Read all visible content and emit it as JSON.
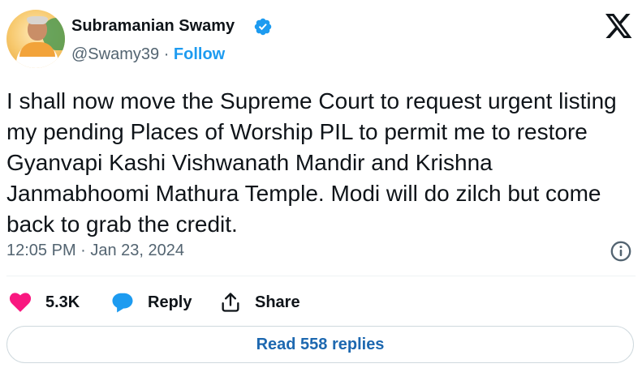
{
  "author": {
    "name": "Subramanian Swamy",
    "handle": "@Swamy39",
    "separator": "·",
    "follow_label": "Follow"
  },
  "icons": {
    "verified": "verified-badge-icon",
    "platform": "x-logo-icon",
    "info": "info-icon",
    "like": "heart-icon",
    "reply": "reply-bubble-icon",
    "share": "share-upload-icon"
  },
  "tweet": {
    "text": "I shall now move the Supreme Court to request urgent listing my pending Places of Worship PIL to permit me to restore Gyanvapi Kashi Vishwanath Mandir and Krishna Janmabhoomi Mathura Temple. Modi will do zilch but come back to grab the credit.",
    "timestamp": "12:05 PM · Jan 23, 2024"
  },
  "actions": {
    "likes": "5.3K",
    "reply_label": "Reply",
    "share_label": "Share"
  },
  "footer": {
    "read_replies_label": "Read 558 replies"
  },
  "colors": {
    "accent": "#1d9bf0",
    "like": "#f91880",
    "text": "#0f1419",
    "muted": "#536471"
  }
}
